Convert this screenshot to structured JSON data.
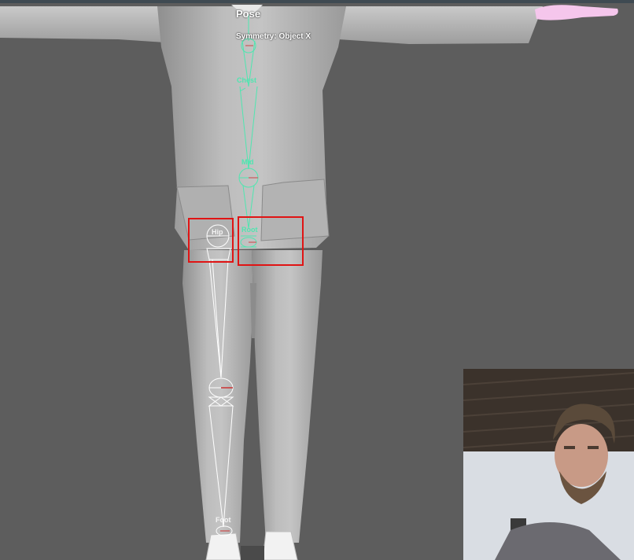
{
  "viewport": {
    "mode_label": "Pose",
    "symmetry_label": "Symmetry: Object X"
  },
  "joints": {
    "chest": "Chest",
    "mid": "Mid",
    "root": "Root",
    "hip": "Hip",
    "foot": "Foot"
  },
  "colors": {
    "background": "#5d5d5d",
    "spine_bones": "#4fe6b0",
    "leg_bones": "#ffffff",
    "highlight_box": "#e01414",
    "hand_mesh": "#f5c6ec"
  },
  "icons": [
    "spine-bone-icon",
    "leg-bone-icon",
    "webcam-feed"
  ]
}
